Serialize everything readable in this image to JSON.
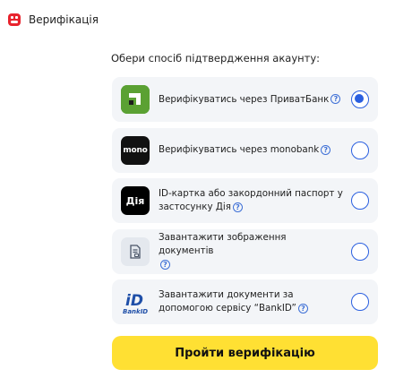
{
  "header": {
    "title": "Верифікація",
    "logo_icon": "brand-logo-icon",
    "accent": "#e8232d"
  },
  "prompt": "Обери спосіб підтвердження акаунту:",
  "options": [
    {
      "icon": "privatbank-icon",
      "label": "Верифікуватись через ПриватБанк",
      "selected": true
    },
    {
      "icon": "monobank-icon",
      "icon_text": "mono",
      "label": "Верифікуватись через monobank",
      "selected": false
    },
    {
      "icon": "diia-icon",
      "icon_text": "Дія",
      "label": "ID-картка або закордонний паспорт у застосунку Дія",
      "selected": false
    },
    {
      "icon": "document-upload-icon",
      "label": "Завантажити зображення документів",
      "selected": false
    },
    {
      "icon": "bankid-icon",
      "icon_text": "BankID",
      "label": "Завантажити документи за допомогою сервісу “BankID”",
      "selected": false
    }
  ],
  "help_symbol": "?",
  "submit_label": "Пройти верифікацію",
  "colors": {
    "radio": "#2a5fe0",
    "button": "#ffe033",
    "card": "#f3f5f8"
  }
}
